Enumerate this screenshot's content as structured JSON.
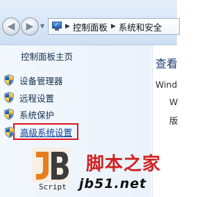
{
  "address_bar": {
    "breadcrumbs": [
      "控制面板",
      "系统和安全"
    ]
  },
  "task_pane": {
    "home_link": "控制面板主页",
    "items": [
      {
        "label": "设备管理器",
        "icon": "uac-shield-icon"
      },
      {
        "label": "远程设置",
        "icon": "uac-shield-icon"
      },
      {
        "label": "系统保护",
        "icon": "uac-shield-icon"
      },
      {
        "label": "高级系统设置",
        "icon": "uac-shield-icon",
        "highlighted": true
      }
    ]
  },
  "content": {
    "title_partial": "查看",
    "lines_partial": [
      "Windo",
      "W",
      "版"
    ]
  },
  "watermark": {
    "logo_text": "Script",
    "site_name": "脚本之家",
    "site_url": "jb51.net"
  },
  "colors": {
    "highlight_border": "#e0141e",
    "link": "#16304f",
    "title": "#1e3f79",
    "watermark_red": "#d22222"
  }
}
